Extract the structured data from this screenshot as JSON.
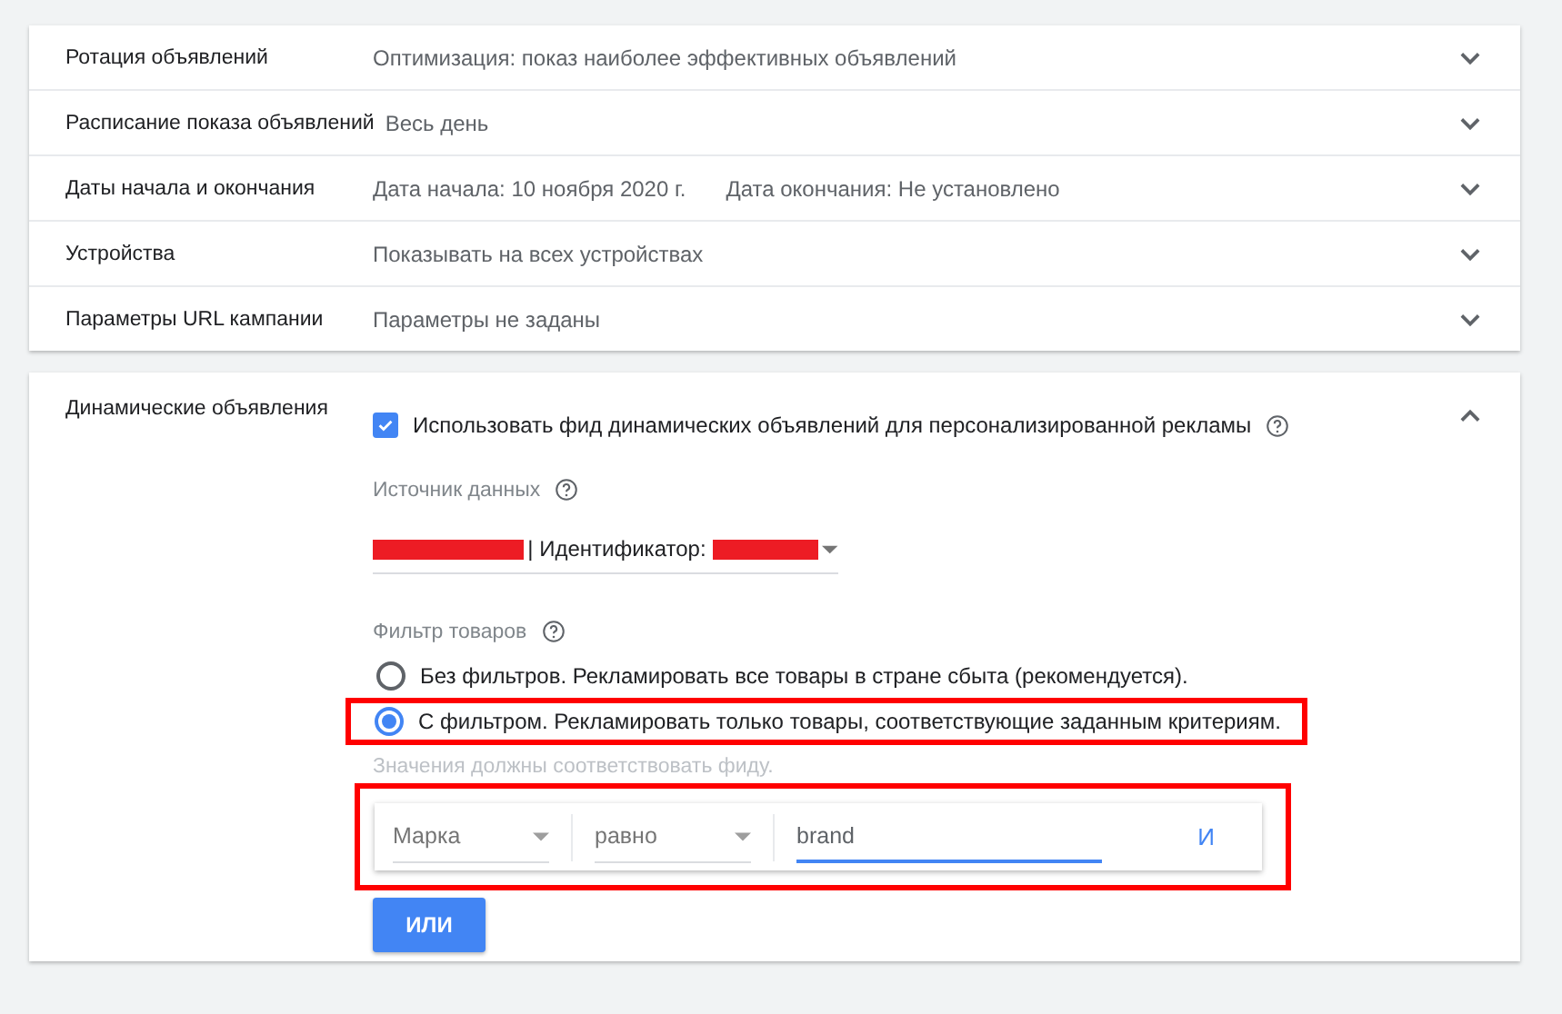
{
  "settings": [
    {
      "label": "Ротация объявлений",
      "values": [
        "Оптимизация: показ наиболее эффективных объявлений"
      ],
      "expanded": false
    },
    {
      "label": "Расписание показа объявлений",
      "values": [
        "Весь день"
      ],
      "expanded": false
    },
    {
      "label": "Даты начала и окончания",
      "values": [
        "Дата начала: 10 ноября 2020 г.",
        "Дата окончания: Не установлено"
      ],
      "expanded": false
    },
    {
      "label": "Устройства",
      "values": [
        "Показывать на всех устройствах"
      ],
      "expanded": false
    },
    {
      "label": "Параметры URL кампании",
      "values": [
        "Параметры не заданы"
      ],
      "expanded": false
    }
  ],
  "dynamic_ads": {
    "label": "Динамические объявления",
    "expanded": true,
    "use_feed": {
      "label": "Использовать фид динамических объявлений для персонализированной рекламы",
      "checked": true
    },
    "data_source": {
      "label": "Источник данных",
      "value": "| Идентификатор:"
    },
    "product_filter": {
      "label": "Фильтр товаров",
      "options": [
        {
          "label": "Без фильтров. Рекламировать все товары в стране сбыта (рекомендуется).",
          "selected": false,
          "highlighted": false
        },
        {
          "label": "С фильтром. Рекламировать только товары, соответствующие заданным критериям.",
          "selected": true,
          "highlighted": true
        }
      ]
    },
    "hint": "Значения должны соответствовать фиду.",
    "condition": {
      "attribute": "Марка",
      "operator": "равно",
      "value": "brand",
      "and_link": "И",
      "highlighted": true
    },
    "or_button": "ИЛИ"
  }
}
